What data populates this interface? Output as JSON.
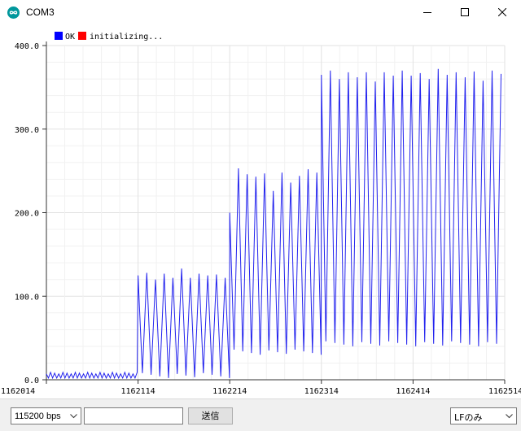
{
  "window": {
    "title": "COM3",
    "app_icon": "arduino-infinity-icon",
    "controls": [
      "minimize-icon",
      "maximize-icon",
      "close-icon"
    ]
  },
  "plotter": {
    "legend": [
      {
        "label": "OK",
        "color": "#0000ff"
      },
      {
        "label": "initializing...",
        "color": "#ff0000"
      }
    ]
  },
  "chart_data": {
    "type": "line",
    "x_tick_labels": [
      "1162014",
      "1162114",
      "1162214",
      "1162314",
      "1162414",
      "1162514"
    ],
    "y_tick_labels": [
      "0.0",
      "100.0",
      "200.0",
      "300.0",
      "400.0"
    ],
    "xlim": [
      1162014,
      1162514
    ],
    "ylim": [
      0,
      400
    ],
    "grid": true,
    "legend_position": "top-left",
    "series": [
      {
        "name": "OK",
        "color": "#2222ee",
        "segments": [
          {
            "x_start": 1162014,
            "x_end": 1162114,
            "period": 4.5,
            "high": 7,
            "low": 1
          },
          {
            "x_start": 1162114,
            "x_end": 1162214,
            "period": 9.5,
            "high": 127,
            "low": 2,
            "peak_variation": [
              125,
              128,
              120,
              127,
              122,
              133,
              122,
              127,
              125,
              126,
              122,
              128,
              122,
              131,
              120
            ]
          },
          {
            "x_start": 1162214,
            "x_end": 1162314,
            "period": 9.5,
            "high": 247,
            "low": 30,
            "peak_variation": [
              200,
              253,
              246,
              243,
              247,
              226,
              248,
              236,
              244,
              252,
              248,
              244,
              249,
              243,
              242
            ]
          },
          {
            "x_start": 1162314,
            "x_end": 1162514,
            "period": 9.8,
            "high": 367,
            "low": 40,
            "peak_variation": [
              365,
              370,
              360,
              368,
              362,
              368,
              357,
              368,
              364,
              370,
              364,
              367,
              360,
              372,
              365,
              368,
              362,
              369,
              358,
              370,
              366,
              368,
              360,
              370
            ]
          }
        ]
      },
      {
        "name": "initializing...",
        "color": "#ff0000",
        "values": []
      }
    ]
  },
  "bottom_bar": {
    "baud_rate": "115200 bps",
    "send_input_value": "",
    "send_button_label": "送信",
    "line_ending": "LFのみ"
  }
}
